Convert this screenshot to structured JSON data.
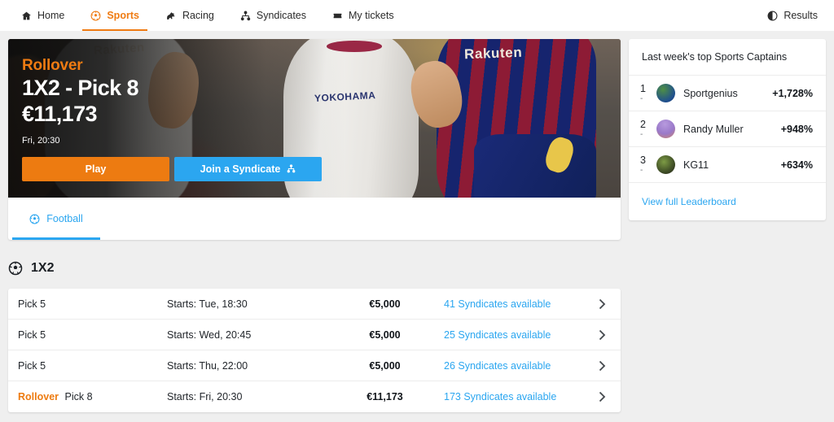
{
  "nav": {
    "items": [
      {
        "label": "Home",
        "icon": "home-icon",
        "active": false
      },
      {
        "label": "Sports",
        "icon": "football-icon",
        "active": true
      },
      {
        "label": "Racing",
        "icon": "horse-icon",
        "active": false
      },
      {
        "label": "Syndicates",
        "icon": "network-icon",
        "active": false
      },
      {
        "label": "My tickets",
        "icon": "ticket-icon",
        "active": false
      }
    ],
    "results_label": "Results",
    "results_icon": "contrast-circle-icon",
    "accent_color": "#ef7b12",
    "link_color": "#2ba6f0"
  },
  "hero": {
    "kicker": "Rollover",
    "title": "1X2 - Pick 8",
    "amount": "€11,173",
    "time": "Fri, 20:30",
    "play_label": "Play",
    "syndicate_label": "Join a Syndicate",
    "syndicate_icon": "network-icon",
    "photo_text_1": "Rakuten",
    "photo_text_2": "Rakuten",
    "photo_text_3": "YOKOHAMA"
  },
  "sport_tabs": [
    {
      "label": "Football",
      "icon": "football-icon",
      "active": true
    }
  ],
  "leaderboard": {
    "heading": "Last week's top Sports Captains",
    "rows": [
      {
        "rank": "1",
        "change": "-",
        "name": "Sportgenius",
        "percent": "+1,728%",
        "avatar_colors": [
          "#3f7f3a",
          "#2a5fa8"
        ]
      },
      {
        "rank": "2",
        "change": "-",
        "name": "Randy Muller",
        "percent": "+948%",
        "avatar_colors": [
          "#a98ad4",
          "#d2836b"
        ]
      },
      {
        "rank": "3",
        "change": "-",
        "name": "KG11",
        "percent": "+634%",
        "avatar_colors": [
          "#6d8a3e",
          "#2f2a22"
        ]
      }
    ],
    "footer_link": "View full Leaderboard"
  },
  "section": {
    "title": "1X2",
    "icon": "football-icon"
  },
  "list": {
    "chevron_icon": "chevron-right-icon",
    "rows": [
      {
        "rollover": "",
        "pick": "Pick 5",
        "starts": "Starts: Tue, 18:30",
        "prize": "€5,000",
        "syndicates": "41 Syndicates available"
      },
      {
        "rollover": "",
        "pick": "Pick 5",
        "starts": "Starts: Wed, 20:45",
        "prize": "€5,000",
        "syndicates": "25 Syndicates available"
      },
      {
        "rollover": "",
        "pick": "Pick 5",
        "starts": "Starts: Thu, 22:00",
        "prize": "€5,000",
        "syndicates": "26 Syndicates available"
      },
      {
        "rollover": "Rollover",
        "pick": "Pick 8",
        "starts": "Starts: Fri, 20:30",
        "prize": "€11,173",
        "syndicates": "173 Syndicates available"
      }
    ]
  }
}
